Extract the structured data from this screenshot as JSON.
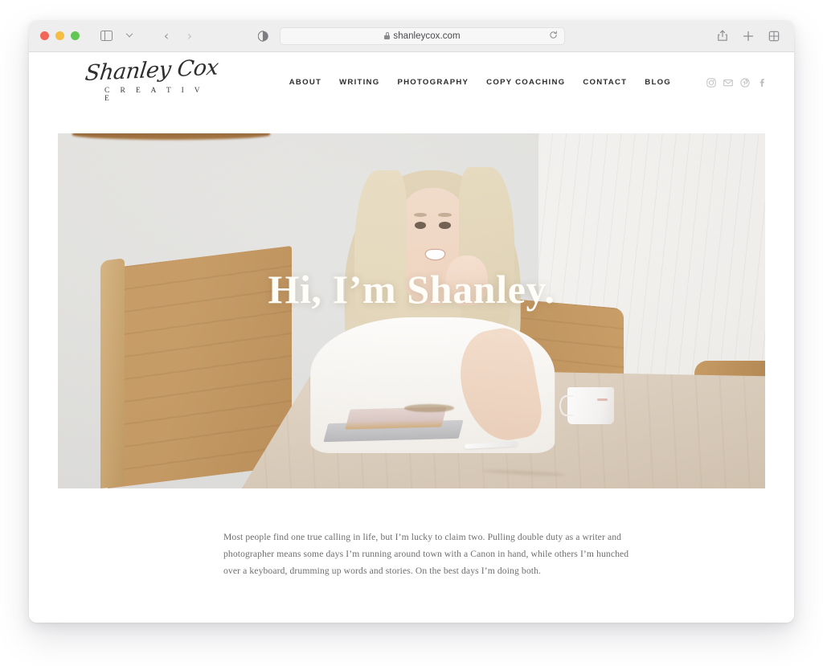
{
  "browser": {
    "window_controls": [
      "close",
      "minimize",
      "maximize"
    ],
    "sidebar_label": "sidebar-toggle",
    "back_label": "‹",
    "forward_label": "›",
    "reader_label": "reader-view",
    "url": "shanleycox.com",
    "reload_label": "reload",
    "share_label": "share",
    "new_tab_label": "+",
    "tabs_overview_label": "tabs-overview"
  },
  "site": {
    "logo": {
      "script": "Shanley Cox",
      "subtitle": "C R E A T I V E"
    },
    "nav": [
      {
        "label": "ABOUT"
      },
      {
        "label": "WRITING"
      },
      {
        "label": "PHOTOGRAPHY"
      },
      {
        "label": "COPY COACHING"
      },
      {
        "label": "CONTACT"
      },
      {
        "label": "BLOG"
      }
    ],
    "socials": [
      {
        "name": "instagram-icon"
      },
      {
        "name": "email-icon"
      },
      {
        "name": "pinterest-icon"
      },
      {
        "name": "facebook-icon"
      }
    ],
    "hero": {
      "title": "Hi, I’m Shanley.",
      "image_alt": "Woman with long blonde hair in a white tee smiling, seated at a light wooden table with a laptop, pink notebook and white mug"
    },
    "intro": {
      "paragraph": "Most people find one true calling in life, but I’m lucky to claim two. Pulling double duty as a writer and photographer means some days I’m running around town with a Canon in hand, while others I’m hunched over a keyboard, drumming up words and stories. On the best days I’m doing both."
    }
  },
  "colors": {
    "page_background": "#ffffff",
    "toolbar_background": "#eeeeef",
    "nav_text": "#2b2b2b",
    "body_text": "#6e6e6e",
    "hero_title": "#fffdf8",
    "social_icon": "#bdbdbd"
  }
}
